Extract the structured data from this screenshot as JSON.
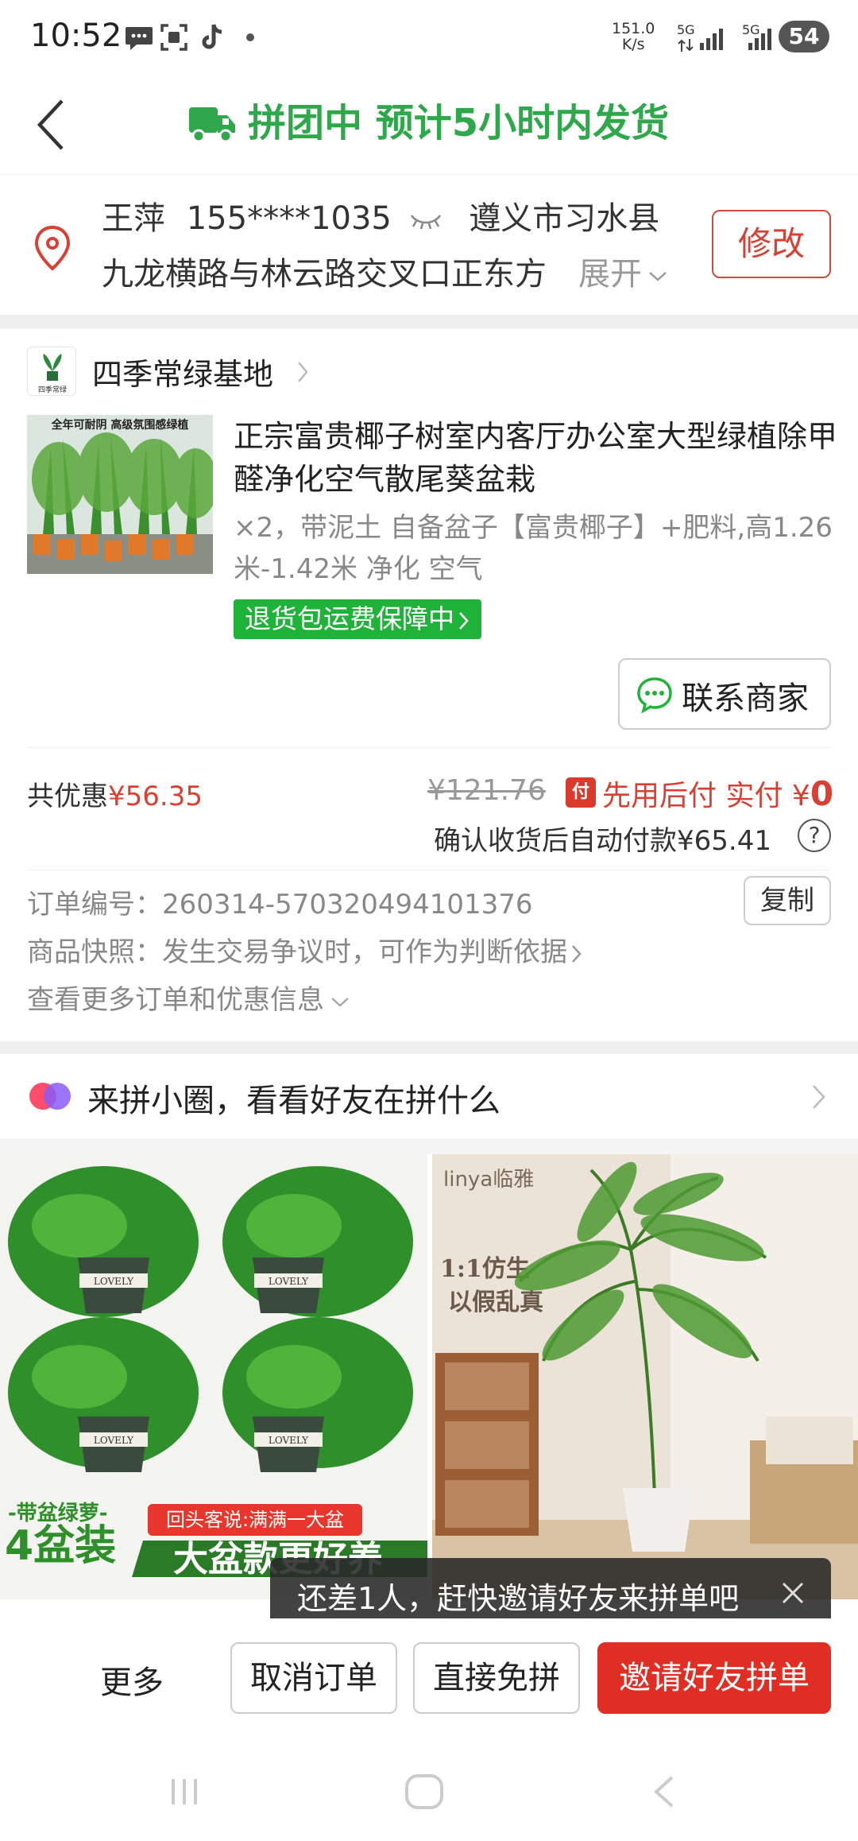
{
  "status": {
    "time": "10:52",
    "speed_value": "151.0",
    "speed_unit": "K/s",
    "net1": "5G",
    "net2": "5G",
    "battery": "54"
  },
  "header": {
    "title": "拼团中 预计5小时内发货",
    "accent": "#2ea84b"
  },
  "address": {
    "name": "王萍",
    "phone": "155****1035",
    "region": "遵义市习水县",
    "detail": "九龙横路与林云路交叉口正东方",
    "expand_label": "展开",
    "edit_label": "修改"
  },
  "store": {
    "name": "四季常绿基地",
    "logo_text": "四季常绿"
  },
  "product": {
    "image_caption": "全年可耐阴  高级氛围感绿植",
    "title": "正宗富贵椰子树室内客厅办公室大型绿植除甲醛净化空气散尾葵盆栽",
    "spec": "×2，带泥土 自备盆子【富贵椰子】+肥料,高1.26米-1.42米 净化 空气",
    "badge": "退货包运费保障中",
    "contact_label": "联系商家"
  },
  "price": {
    "discount_label": "共优惠",
    "discount_value": "¥56.35",
    "original_price": "¥121.76",
    "pay_later_icon": "付",
    "pay_later_label": "先用后付 实付",
    "pay_currency": "¥",
    "pay_value": "0",
    "auto_pay": "确认收货后自动付款¥65.41",
    "help": "?"
  },
  "order": {
    "number_label": "订单编号：",
    "number": "260314-570320494101376",
    "copy_label": "复制",
    "snapshot": "商品快照：发生交易争议时，可作为判断依据",
    "more_info": "查看更多订单和优惠信息"
  },
  "circle": {
    "text": "来拼小圈，看看好友在拼什么"
  },
  "recommendations": {
    "left": {
      "tag": "-带盆绿萝-",
      "count": "4盆装",
      "review": "回头客说:满满一大盆",
      "slogan": "大盆款更好养",
      "pot_label": "LOVELY"
    },
    "right": {
      "brand": "linya临雅",
      "slogan1": "1:1仿生",
      "slogan2": "以假乱真"
    }
  },
  "toast": {
    "text": "还差1人，赶快邀请好友来拼单吧"
  },
  "actions": {
    "more": "更多",
    "cancel": "取消订单",
    "free": "直接免拼",
    "invite": "邀请好友拼单",
    "accent": "#e02e24"
  }
}
